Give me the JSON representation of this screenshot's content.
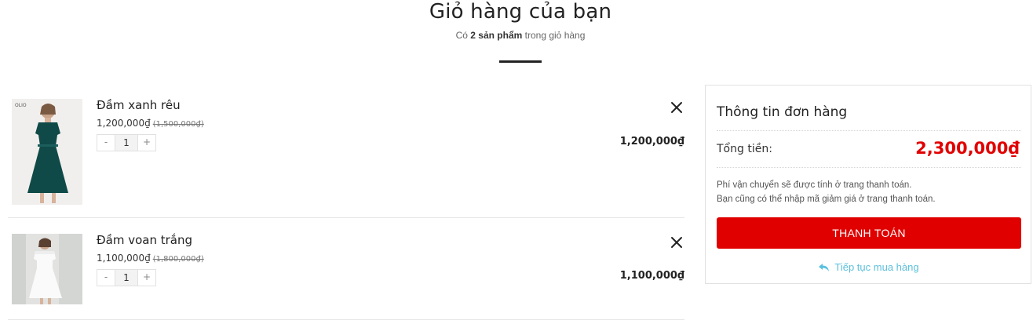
{
  "header": {
    "title": "Giỏ hàng của bạn",
    "subtitle_prefix": "Có",
    "subtitle_count": "2 sản phẩm",
    "subtitle_suffix": "trong giỏ hàng"
  },
  "cart": {
    "items": [
      {
        "name": "Đầm xanh rêu",
        "price": "1,200,000₫",
        "old_price": "(1,500,000₫)",
        "quantity": "1",
        "minus": "-",
        "plus": "+",
        "line_total": "1,200,000₫",
        "image_icon": "dress-photo-green",
        "image_brand": "OLIO"
      },
      {
        "name": "Đầm voan trắng",
        "price": "1,100,000₫",
        "old_price": "(1,800,000₫)",
        "quantity": "1",
        "minus": "-",
        "plus": "+",
        "line_total": "1,100,000₫",
        "image_icon": "dress-photo-white"
      }
    ]
  },
  "summary": {
    "title": "Thông tin đơn hàng",
    "total_label": "Tổng tiền:",
    "total_value": "2,300,000₫",
    "note_line1": "Phí vận chuyển sẽ được tính ở trang thanh toán.",
    "note_line2": "Bạn cũng có thể nhập mã giảm giá ở trang thanh toán.",
    "checkout_label": "THANH TOÁN",
    "continue_label": "Tiếp tục mua hàng",
    "continue_icon": "reply-arrow-icon"
  },
  "colors": {
    "accent": "#e00000",
    "link": "#5bc0de",
    "text": "#222222"
  }
}
